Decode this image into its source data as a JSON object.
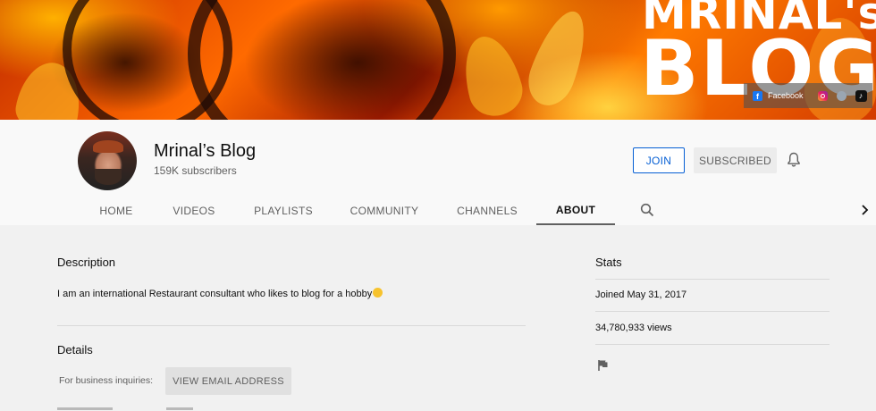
{
  "banner": {
    "brand_line1": "MRINAL's",
    "brand_line2": "BLOG",
    "links": [
      {
        "name": "Facebook",
        "icon": "facebook-icon"
      },
      {
        "name": "",
        "icon": "instagram-icon"
      },
      {
        "name": "",
        "icon": "globe-icon"
      },
      {
        "name": "",
        "icon": "tiktok-icon"
      }
    ]
  },
  "channel": {
    "name": "Mrinal’s Blog",
    "subscribers": "159K subscribers",
    "join_label": "JOIN",
    "subscribed_label": "SUBSCRIBED"
  },
  "tabs": [
    "HOME",
    "VIDEOS",
    "PLAYLISTS",
    "COMMUNITY",
    "CHANNELS",
    "ABOUT"
  ],
  "active_tab": "ABOUT",
  "about": {
    "description_heading": "Description",
    "description": "I am an international Restaurant consultant who likes to blog for a hobby",
    "details_heading": "Details",
    "business_label": "For business inquiries:",
    "email_button": "VIEW EMAIL ADDRESS"
  },
  "stats": {
    "heading": "Stats",
    "joined": "Joined May 31, 2017",
    "views": "34,780,933 views"
  },
  "colors": {
    "accent_blue": "#065fd4",
    "text_secondary": "#606060",
    "page_bg": "#f1f1f1"
  }
}
